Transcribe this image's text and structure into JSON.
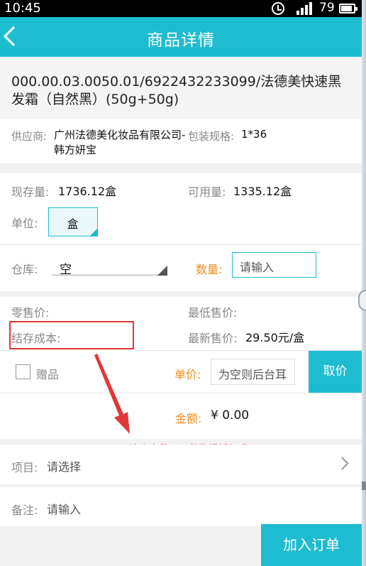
{
  "status_bar": {
    "time": "10:45",
    "battery_level": "79"
  },
  "header": {
    "title": "商品详情"
  },
  "product": {
    "name": "000.00.03.0050.01/6922432233099/法德美快速黑发霜（自然黑）(50g+50g)"
  },
  "supplier": {
    "label": "供应商:",
    "value": "广州法德美化妆品有限公司-韩方妍宝",
    "pack_label": "包装规格:",
    "pack_value": "1*36"
  },
  "stock": {
    "on_hand_label": "现存量:",
    "on_hand_value": "1736.12盒",
    "available_label": "可用量:",
    "available_value": "1335.12盒",
    "unit_label": "单位:",
    "unit_value": "盒",
    "warehouse_label": "仓库:",
    "warehouse_value": "空",
    "quantity_label": "数量:",
    "quantity_placeholder": "请输入"
  },
  "pricing": {
    "retail_label": "零售价:",
    "min_price_label": "最低售价:",
    "cost_label": "结存成本:",
    "latest_price_label": "最新售价:",
    "latest_price_value": "29.50元/盒",
    "gift_label": "赠品",
    "unit_price_label": "单价:",
    "unit_price_placeholder": "为空则后台耳",
    "get_price_button": "取价",
    "amount_label": "金额:",
    "amount_value": "¥ 0.00"
  },
  "annotation": {
    "text": "这个字段可以做数据授权吗？",
    "color": "#e0383a"
  },
  "project": {
    "label": "项目:",
    "value": "请选择"
  },
  "remark": {
    "label": "备注:",
    "placeholder": "请输入"
  },
  "footer": {
    "add_order_button": "加入订单"
  },
  "colors": {
    "accent": "#1ebcd0",
    "highlight": "#f08c1e",
    "annotation": "#e0383a"
  }
}
